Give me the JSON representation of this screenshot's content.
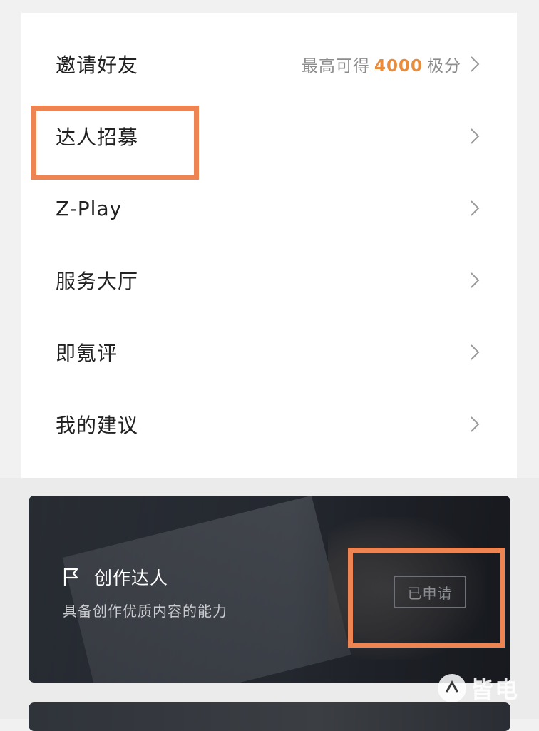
{
  "menu": {
    "items": [
      {
        "label": "邀请好友",
        "extra_prefix": "最高可得",
        "extra_number": "4000",
        "extra_suffix": "极分"
      },
      {
        "label": "达人招募"
      },
      {
        "label": "Z-Play"
      },
      {
        "label": "服务大厅"
      },
      {
        "label": "即氪评"
      },
      {
        "label": "我的建议"
      }
    ]
  },
  "promo": {
    "title": "创作达人",
    "description": "具备创作优质内容的能力",
    "status_button": "已申请",
    "flag_icon": "flag-icon"
  },
  "watermark": {
    "text": "皆电"
  },
  "colors": {
    "highlight": "#ee8452",
    "accent_number": "#e98d3c"
  }
}
